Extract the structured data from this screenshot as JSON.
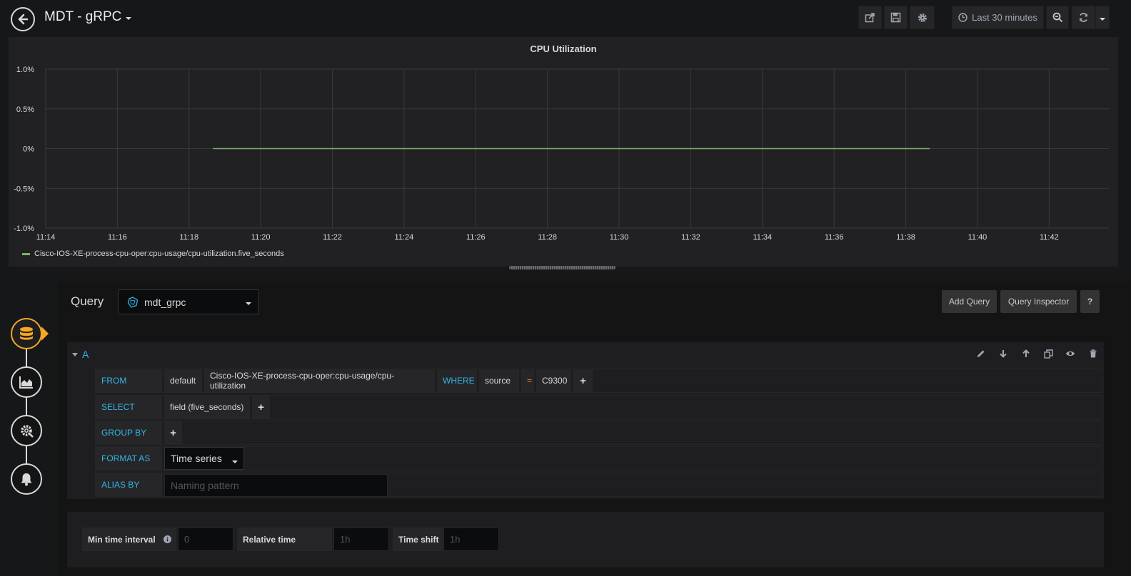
{
  "header": {
    "title": "MDT - gRPC",
    "time_range_label": "Last 30 minutes"
  },
  "panel": {
    "title": "CPU Utilization",
    "legend": "Cisco-IOS-XE-process-cpu-oper:cpu-usage/cpu-utilization.five_seconds"
  },
  "chart_data": {
    "type": "line",
    "title": "CPU Utilization",
    "y_ticks": [
      "1.0%",
      "0.5%",
      "0%",
      "-0.5%",
      "-1.0%"
    ],
    "x_ticks": [
      "11:14",
      "11:16",
      "11:18",
      "11:20",
      "11:22",
      "11:24",
      "11:26",
      "11:28",
      "11:30",
      "11:32",
      "11:34",
      "11:36",
      "11:38",
      "11:40",
      "11:42"
    ],
    "ylim": [
      -1.0,
      1.0
    ],
    "xlim": [
      "11:14",
      "11:43:40"
    ],
    "grid": true,
    "legend_position": "bottom-left",
    "series": [
      {
        "name": "Cisco-IOS-XE-process-cpu-oper:cpu-usage/cpu-utilization.five_seconds",
        "color": "#7eb26d",
        "x": [
          "11:18:40",
          "11:38:40"
        ],
        "values": [
          0,
          0
        ]
      }
    ]
  },
  "editor": {
    "query_label": "Query",
    "datasource": "mdt_grpc",
    "add_query": "Add Query",
    "query_inspector": "Query Inspector",
    "help": "?",
    "ref_id": "A",
    "from_label": "FROM",
    "policy": "default",
    "measurement": "Cisco-IOS-XE-process-cpu-oper:cpu-usage/cpu-utilization",
    "where_label": "WHERE",
    "where_key": "source",
    "where_op": "=",
    "where_value": "C9300",
    "select_label": "SELECT",
    "select_field": "field (five_seconds)",
    "group_by_label": "GROUP BY",
    "format_as_label": "FORMAT AS",
    "format_value": "Time series",
    "alias_by_label": "ALIAS BY",
    "alias_placeholder": "Naming pattern",
    "plus": "+"
  },
  "options": {
    "min_interval_label": "Min time interval",
    "min_interval_placeholder": "0",
    "relative_time_label": "Relative time",
    "relative_time_placeholder": "1h",
    "time_shift_label": "Time shift",
    "time_shift_placeholder": "1h"
  },
  "colors": {
    "accent_keyword": "#33b5e5",
    "operator": "#eb7b18",
    "series": "#7eb26d",
    "active_step": "#f5a623"
  }
}
